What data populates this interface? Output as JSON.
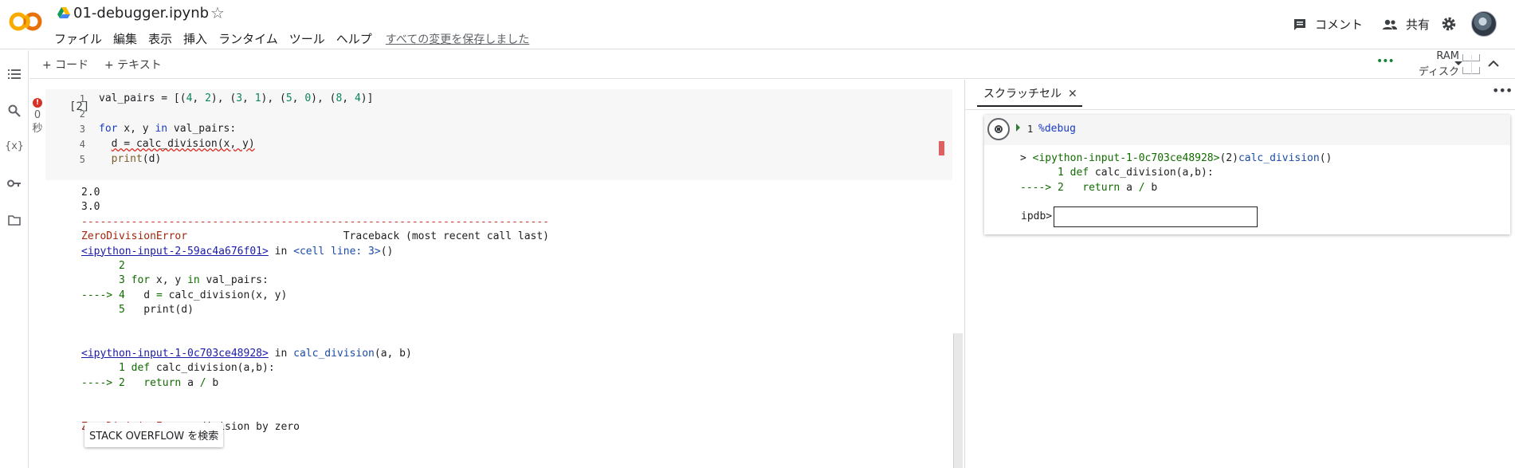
{
  "header": {
    "title": "01-debugger.ipynb",
    "menu": [
      "ファイル",
      "編集",
      "表示",
      "挿入",
      "ランタイム",
      "ツール",
      "ヘルプ"
    ],
    "saved_text": "すべての変更を保存しました",
    "comment_label": "コメント",
    "share_label": "共有"
  },
  "toolbar": {
    "add_code": "+ コード",
    "add_text": "+ テキスト",
    "ram_label": "RAM",
    "disk_label": "ディスク"
  },
  "cell": {
    "exec_count": "[2]",
    "exec_time": "0",
    "exec_time_unit": "秒",
    "line_numbers": [
      "1",
      "2",
      "3",
      "4",
      "5"
    ]
  },
  "output": {
    "line1": "2.0",
    "line2": "3.0",
    "dashes": "---------------------------------------------------------------------------",
    "err_name": "ZeroDivisionError",
    "traceback_hdr": "                         Traceback (most recent call last)",
    "input2_link": "<ipython-input-2-59ac4a676f01>",
    "in_word": " in ",
    "cell_line": "<cell line: 3>",
    "parens": "()",
    "input1_link": "<ipython-input-1-0c703ce48928>",
    "calc_division": "calc_division",
    "args": "(a, b)",
    "final_err": ": division by zero",
    "so_button": "STACK OVERFLOW を検索"
  },
  "scratch": {
    "tab_label": "スクラッチセル",
    "cell_line_no": "1",
    "cell_code": "%debug",
    "out_prefix": "> ",
    "out_input": "<ipython-input-1-0c703ce48928>",
    "out_lineref": "(2)",
    "out_func": "calc_division",
    "out_call": "()",
    "ipdb_prompt": "ipdb>"
  }
}
